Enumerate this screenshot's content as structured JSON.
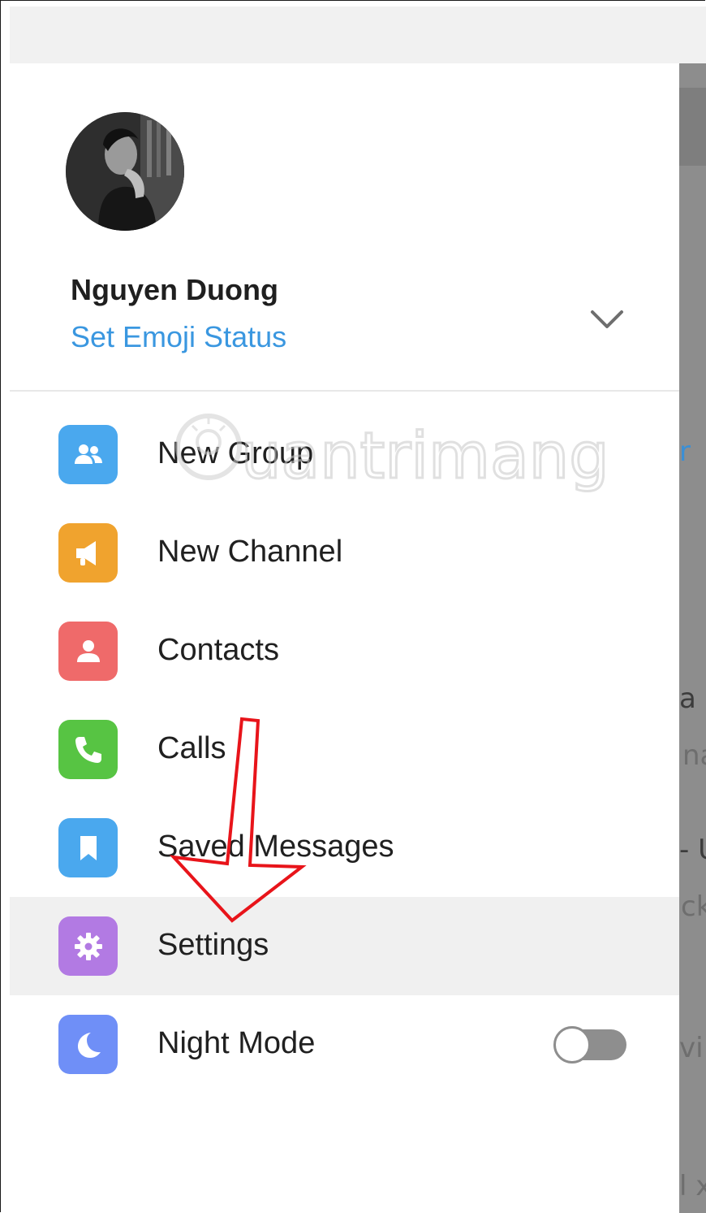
{
  "profile": {
    "name": "Nguyen Duong",
    "status_link": "Set Emoji Status",
    "expand_icon": "chevron-down-icon"
  },
  "menu": {
    "items": [
      {
        "label": "New Group",
        "icon": "people-icon",
        "color": "#4aa8ee"
      },
      {
        "label": "New Channel",
        "icon": "megaphone-icon",
        "color": "#f0a32e"
      },
      {
        "label": "Contacts",
        "icon": "person-icon",
        "color": "#ef6a6a"
      },
      {
        "label": "Calls",
        "icon": "phone-icon",
        "color": "#57c443"
      },
      {
        "label": "Saved Messages",
        "icon": "bookmark-icon",
        "color": "#4aa8ee"
      },
      {
        "label": "Settings",
        "icon": "gear-icon",
        "color": "#b27ae3",
        "highlighted": true
      },
      {
        "label": "Night Mode",
        "icon": "moon-icon",
        "color": "#6f8ff7",
        "toggle": false
      }
    ]
  },
  "background_fragments": [
    "r",
    "a -",
    "na",
    "- U",
    "ck",
    "vi",
    "l x"
  ],
  "watermark": {
    "text": "uantrimang"
  },
  "accent_colors": {
    "link": "#3a97e0",
    "annotation_arrow": "#e8141a"
  }
}
